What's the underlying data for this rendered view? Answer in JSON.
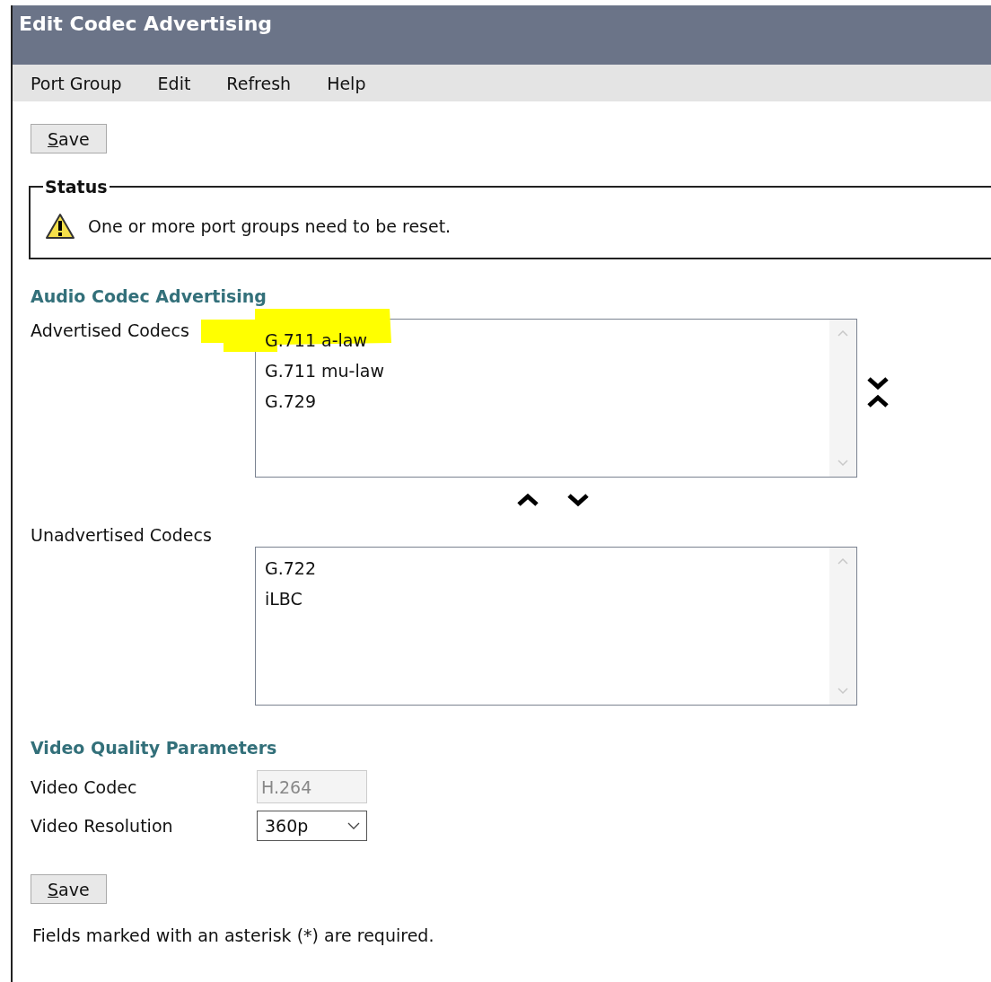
{
  "window": {
    "title": "Edit Codec Advertising"
  },
  "menu": [
    "Port Group",
    "Edit",
    "Refresh",
    "Help"
  ],
  "save_button_top": "Save",
  "status": {
    "legend": "Status",
    "message": "One or more port groups need to be reset."
  },
  "audio": {
    "heading": "Audio Codec Advertising",
    "advertised": {
      "label": "Advertised Codecs",
      "highlighter_mark": true,
      "items": [
        {
          "text": "G.711 a-law"
        },
        {
          "text": "G.711 mu-law"
        },
        {
          "text": "G.729"
        }
      ]
    },
    "unadvertised": {
      "label": "Unadvertised Codecs",
      "items": [
        {
          "text": "G.722"
        },
        {
          "text": "iLBC"
        }
      ]
    }
  },
  "video": {
    "heading": "Video Quality Parameters",
    "fields": [
      {
        "label": "Video Codec",
        "kind": "readonly",
        "value": "H.264"
      },
      {
        "label": "Video Resolution",
        "kind": "select",
        "value": "360p"
      }
    ]
  },
  "save_button_bottom": "Save",
  "footer": "Fields marked with an asterisk (*) are required."
}
